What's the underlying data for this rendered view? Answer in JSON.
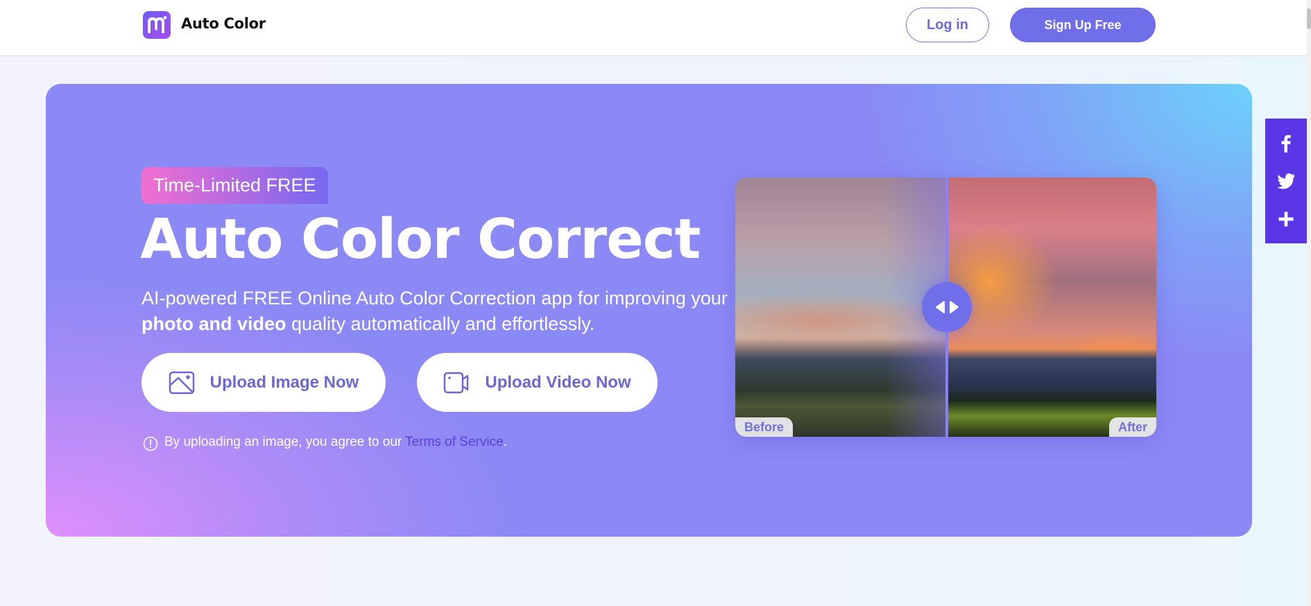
{
  "header": {
    "logo_icon": "media-io-logo-icon",
    "brand": "Auto Color",
    "login_label": "Log in",
    "signup_label": "Sign Up Free"
  },
  "hero": {
    "badge": "Time-Limited FREE",
    "title": "Auto Color Correct",
    "subtitle_line1": "AI-powered FREE Online Auto Color Correction app for improving your",
    "subtitle_bold": "photo and video",
    "subtitle_rest": " quality automatically and effortlessly.",
    "upload_image_label": "Upload Image Now",
    "upload_video_label": "Upload Video Now",
    "notice_text": "By uploading an image, you agree to our ",
    "tos_link": "Terms of Service",
    "notice_end": "."
  },
  "compare": {
    "before_label": "Before",
    "after_label": "After",
    "handle_icon": "left-right-arrows-icon"
  },
  "social": [
    {
      "name": "facebook-icon"
    },
    {
      "name": "twitter-icon"
    },
    {
      "name": "plus-share-icon"
    }
  ],
  "colors": {
    "accent": "#716eea",
    "social_bg": "#5a36e6",
    "link": "#5b3fd6"
  }
}
